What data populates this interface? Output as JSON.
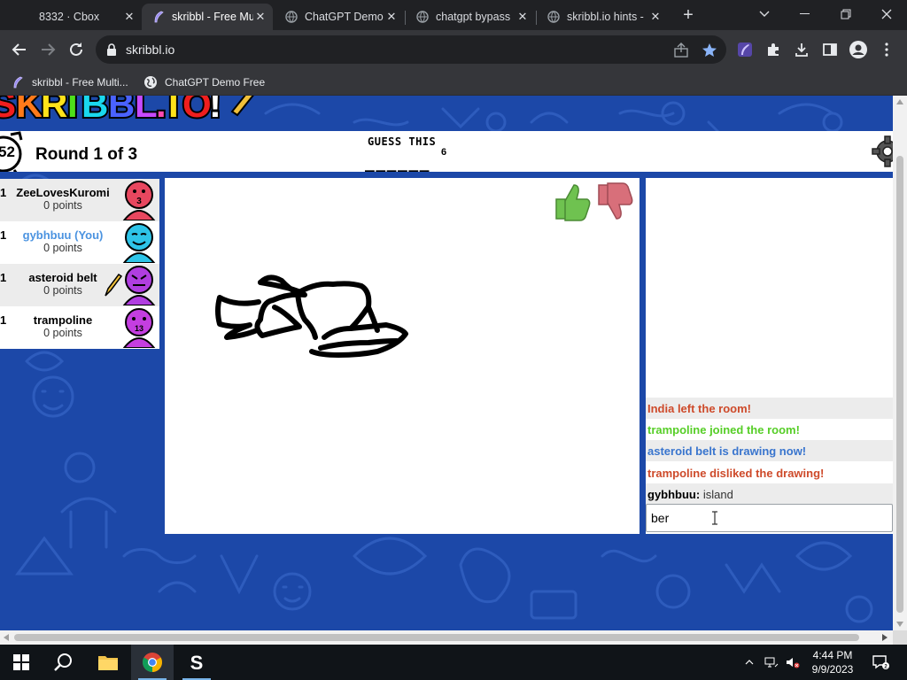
{
  "browser": {
    "tabs": [
      {
        "title": "8332 · Cbox",
        "active": false
      },
      {
        "title": "skribbl - Free Mu",
        "active": true
      },
      {
        "title": "ChatGPT Demo",
        "active": false
      },
      {
        "title": "chatgpt bypass",
        "active": false
      },
      {
        "title": "skribbl.io hints -",
        "active": false
      }
    ],
    "url": "skribbl.io",
    "bookmarks": [
      {
        "label": "skribbl - Free Multi..."
      },
      {
        "label": "ChatGPT Demo Free"
      }
    ]
  },
  "game": {
    "timer": "52",
    "round_label": "Round 1 of 3",
    "guess_label": "GUESS THIS",
    "word_blanks": "______",
    "word_length": "6",
    "players": [
      {
        "rank": "1",
        "name": "ZeeLovesKuromi",
        "points": "0 points",
        "you": false,
        "avatar_color": "#e8475f",
        "badge": "3"
      },
      {
        "rank": "1",
        "name": "gybhbuu (You)",
        "points": "0 points",
        "you": true,
        "avatar_color": "#2ec4e8",
        "badge": ""
      },
      {
        "rank": "1",
        "name": "asteroid belt",
        "points": "0 points",
        "you": false,
        "avatar_color": "#b03ee0",
        "badge": ""
      },
      {
        "rank": "1",
        "name": "trampoline",
        "points": "0 points",
        "you": false,
        "avatar_color": "#c43ee0",
        "badge": "13"
      }
    ],
    "chat": [
      {
        "text": "India left the room!",
        "color": "#ce4a2a",
        "alt": true
      },
      {
        "text": "trampoline joined the room!",
        "color": "#56ce27",
        "alt": false
      },
      {
        "text": "asteroid belt is drawing now!",
        "color": "#3975ce",
        "alt": true
      },
      {
        "text": "trampoline disliked the drawing!",
        "color": "#ce4a2a",
        "alt": false
      },
      {
        "who": "gybhbuu:",
        "what": " island",
        "alt": true
      }
    ],
    "chat_input_value": "ber",
    "colors": {
      "background": "#1c48a8",
      "like": "#6fc250",
      "dislike": "#d86f7a"
    }
  },
  "taskbar": {
    "time": "4:44 PM",
    "date": "9/9/2023"
  }
}
